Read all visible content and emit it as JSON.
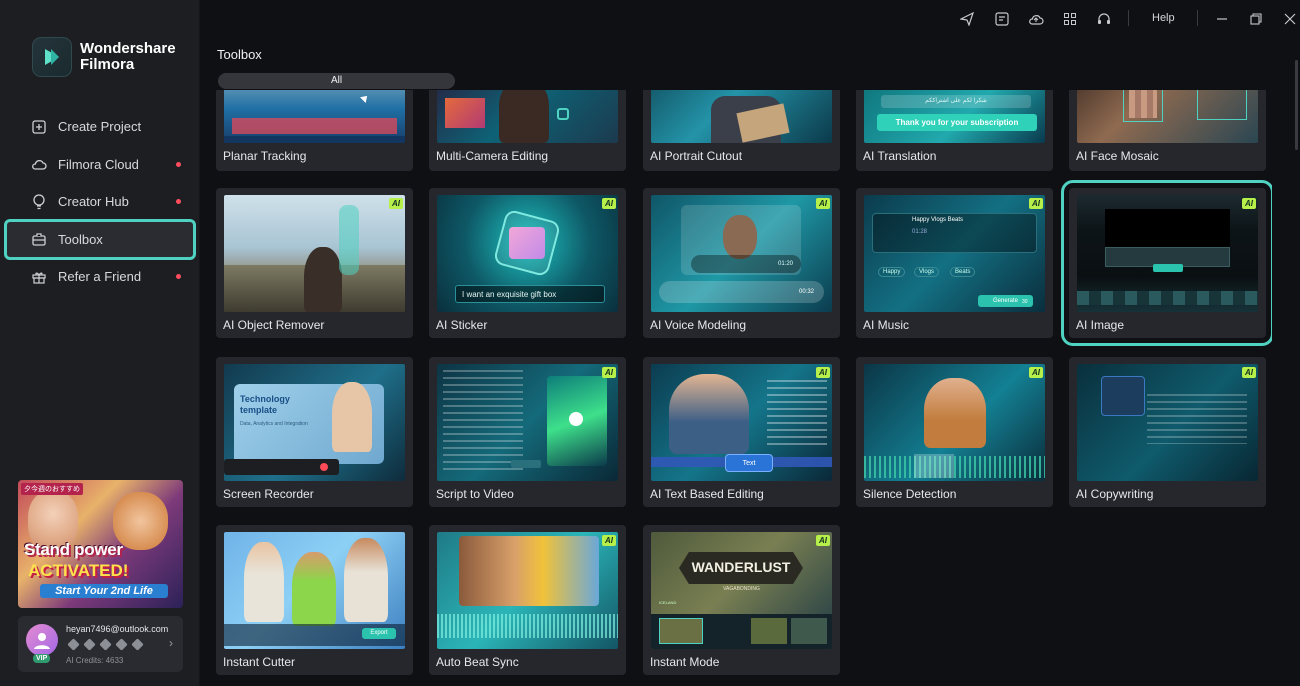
{
  "app": {
    "brand_line1": "Wondershare",
    "brand_line2": "Filmora"
  },
  "sidebar": {
    "items": [
      {
        "label": "Create Project",
        "icon": "plus-square-icon",
        "dot": false
      },
      {
        "label": "Filmora Cloud",
        "icon": "cloud-icon",
        "dot": true
      },
      {
        "label": "Creator Hub",
        "icon": "bulb-icon",
        "dot": true
      },
      {
        "label": "Toolbox",
        "icon": "toolbox-icon",
        "dot": false,
        "active": true
      },
      {
        "label": "Refer a Friend",
        "icon": "gift-icon",
        "dot": true
      }
    ]
  },
  "promo": {
    "tag": "夕今週のおすすめ",
    "line1": "Stand power",
    "line2": "ACTIVATED!",
    "line3": "Start Your 2nd Life"
  },
  "account": {
    "email": "heyan7496@outlook.com",
    "badge": "VIP",
    "credits": "AI Credits: 4633"
  },
  "topbar": {
    "help": "Help",
    "icons": [
      "send-icon",
      "media-icon",
      "cloud-upload-icon",
      "grid-icon",
      "headset-icon",
      "minimize-icon",
      "restore-icon",
      "close-icon"
    ]
  },
  "main": {
    "title": "Toolbox",
    "tab": "All"
  },
  "cards": [
    {
      "label": "Planar Tracking",
      "ai": false
    },
    {
      "label": "Multi-Camera Editing",
      "ai": false
    },
    {
      "label": "AI Portrait Cutout",
      "ai": false
    },
    {
      "label": "AI Translation",
      "ai": false
    },
    {
      "label": "AI Face Mosaic",
      "ai": false
    },
    {
      "label": "AI Object Remover",
      "ai": true
    },
    {
      "label": "AI Sticker",
      "ai": true
    },
    {
      "label": "AI Voice Modeling",
      "ai": true
    },
    {
      "label": "AI Music",
      "ai": true
    },
    {
      "label": "AI Image",
      "ai": true,
      "selected": true
    },
    {
      "label": "Screen Recorder",
      "ai": false
    },
    {
      "label": "Script to Video",
      "ai": true
    },
    {
      "label": "AI Text Based Editing",
      "ai": true
    },
    {
      "label": "Silence Detection",
      "ai": true
    },
    {
      "label": "AI Copywriting",
      "ai": true
    },
    {
      "label": "Instant Cutter",
      "ai": false
    },
    {
      "label": "Auto Beat Sync",
      "ai": true
    },
    {
      "label": "Instant Mode",
      "ai": true
    }
  ],
  "thumb_text": {
    "translation_line1": "شكرا لكم على اشتراككم",
    "translation_line2": "Thank you for your subscription",
    "sticker_prompt": "I want an exquisite gift box",
    "voice_time1": "01:20",
    "voice_time2": "00:32",
    "music_title": "Happy Vlogs Beats",
    "music_time": "01:28",
    "music_tag1": "Happy",
    "music_tag2": "Vlogs",
    "music_tag3": "Beats",
    "music_generate": "Generate",
    "music_count": "30",
    "recorder_title": "Technology template",
    "recorder_sub": "Data, Analytics and Integration",
    "textedit_btn": "Text",
    "cutter_export": "Export",
    "instant_title": "WANDERLUST",
    "instant_sub": "VAGABONDING",
    "instant_loc": "ICELAND"
  },
  "colors": {
    "accent": "#4fd2c1",
    "ai_badge": "#b7f04a",
    "notification_dot": "#ff4d5e"
  }
}
